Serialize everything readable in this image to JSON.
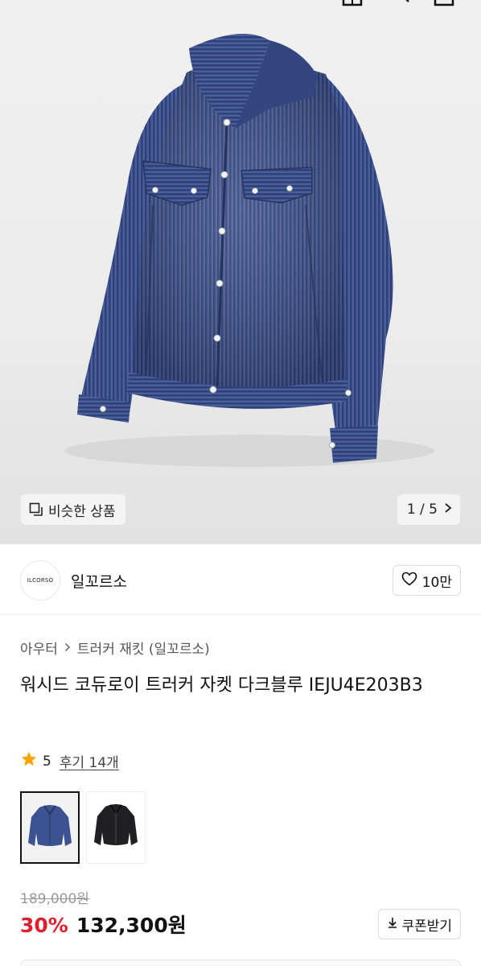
{
  "hero": {
    "similar_label": "비슷한 상품",
    "counter": "1 / 5"
  },
  "brand": {
    "logo_text": "ILCORSO",
    "name": "일꼬르소",
    "like_count": "10만"
  },
  "breadcrumb": {
    "category": "아우터",
    "subcategory": "트러커 재킷 (일꼬르소)"
  },
  "product": {
    "title": "워시드 코듀로이 트러커 자켓 다크블루 IEJU4E203B3",
    "rating": "5",
    "review_label": "후기 14개"
  },
  "price": {
    "original": "189,000원",
    "discount": "30%",
    "sale": "132,300원",
    "coupon_label": "쿠폰받기"
  },
  "colors": {
    "accent_red": "#e0202e",
    "star": "#f5a300",
    "jacket_blue": "#3a4f8a"
  }
}
